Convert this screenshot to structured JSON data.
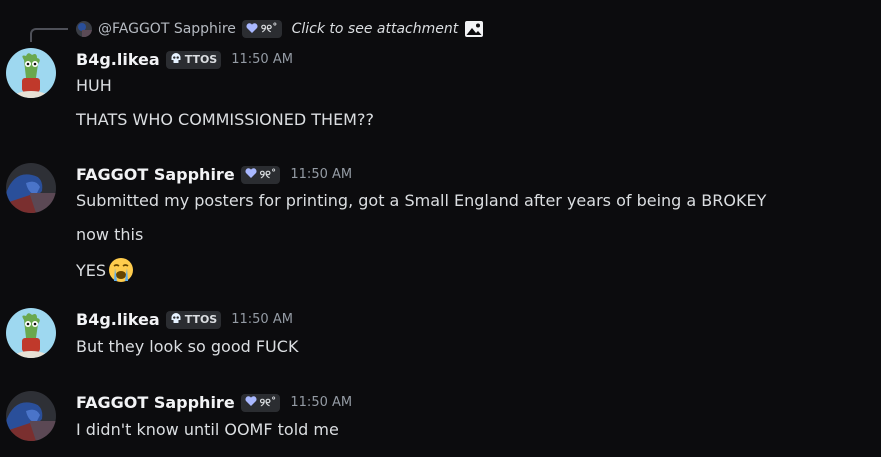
{
  "reply": {
    "username": "@FAGGOT Sapphire",
    "tag_text": "୨୧˚",
    "hint": "Click to see attachment",
    "icon": "image-icon"
  },
  "messages": [
    {
      "username": "B4g.likea",
      "tag_text": "TTOS",
      "tag_icon": "skull-icon",
      "time": "11:50 AM",
      "lines": [
        "HUH",
        "THATS WHO COMMISSIONED THEM??"
      ]
    },
    {
      "username": "FAGGOT Sapphire",
      "tag_text": "୨୧˚",
      "tag_icon": "heart-icon",
      "time": "11:50 AM",
      "lines": [
        "Submitted my posters for printing, got a Small England after years of being a BROKEY",
        "now this",
        "YES"
      ],
      "emoji": "loudly-crying-face-emoji"
    },
    {
      "username": "B4g.likea",
      "tag_text": "TTOS",
      "tag_icon": "skull-icon",
      "time": "11:50 AM",
      "lines": [
        "But they look so good FUCK"
      ]
    },
    {
      "username": "FAGGOT Sapphire",
      "tag_text": "୨୧˚",
      "tag_icon": "heart-icon",
      "time": "11:50 AM",
      "lines": [
        "I didn't know until OOMF told me"
      ]
    }
  ],
  "colors": {
    "background": "#0c0c0e",
    "username": "#f2f3f5",
    "text": "#dbdee1",
    "timestamp": "#949ba4",
    "tag_bg": "#2b2d31"
  }
}
